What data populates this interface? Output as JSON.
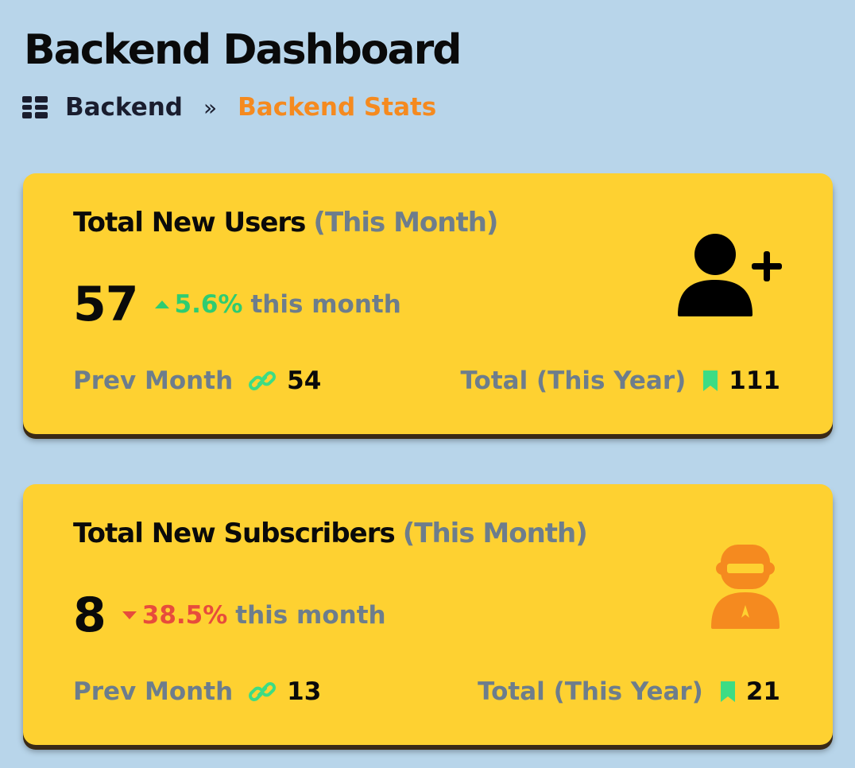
{
  "page": {
    "title": "Backend Dashboard"
  },
  "breadcrumb": {
    "icon": "dashboard-grid-icon",
    "home": "Backend",
    "separator": "»",
    "current": "Backend Stats"
  },
  "cards": [
    {
      "title": "Total New Users",
      "period": "(This Month)",
      "value": "57",
      "trend_direction": "up",
      "trend_value": "5.6%",
      "trend_label": "this month",
      "prev_label": "Prev Month",
      "prev_value": "54",
      "total_label": "Total (This Year)",
      "total_value": "111",
      "icon": "user-plus-icon"
    },
    {
      "title": "Total New Subscribers",
      "period": "(This Month)",
      "value": "8",
      "trend_direction": "down",
      "trend_value": "38.5%",
      "trend_label": "this month",
      "prev_label": "Prev Month",
      "prev_value": "13",
      "total_label": "Total (This Year)",
      "total_value": "21",
      "icon": "subscriber-astronaut-icon"
    }
  ],
  "colors": {
    "background": "#b8d5ea",
    "card": "#fed131",
    "accent_orange": "#f58a1f",
    "up": "#2ecc71",
    "down": "#e74c3c",
    "muted": "#6d7d8c"
  }
}
